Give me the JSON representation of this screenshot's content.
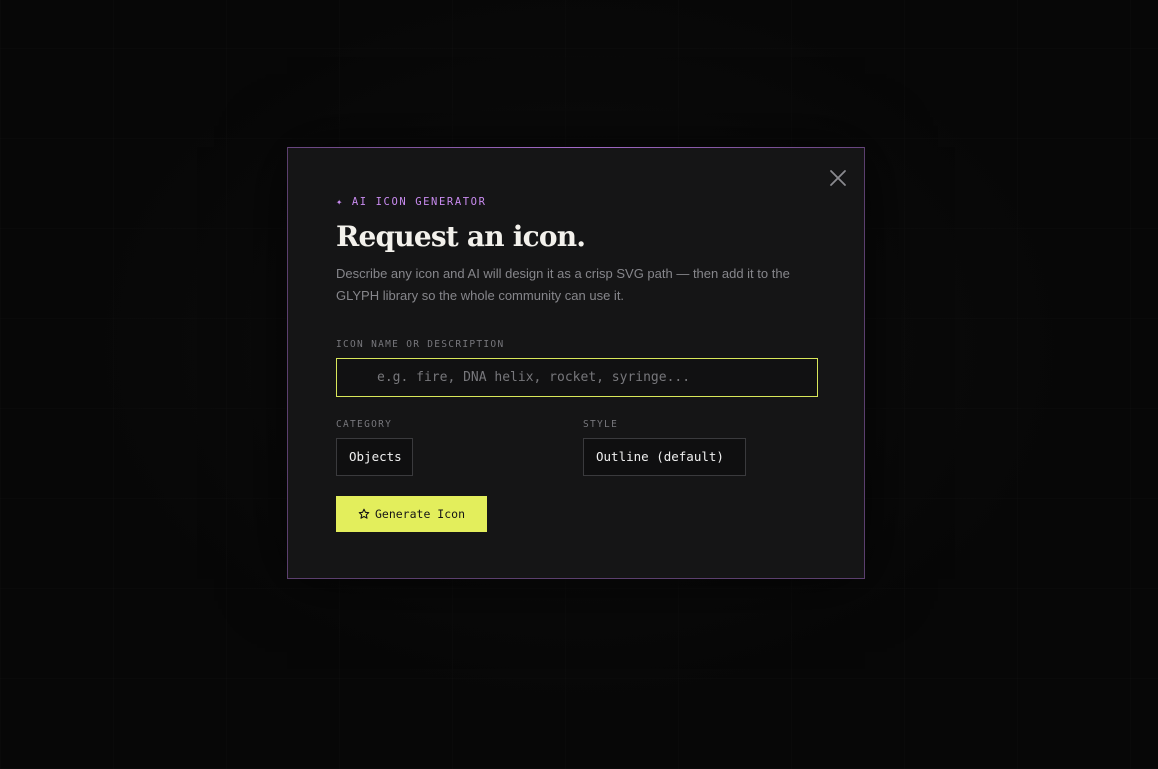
{
  "modal": {
    "eyebrow": "✦ AI ICON GENERATOR",
    "title": "Request an icon.",
    "description": "Describe any icon and AI will design it as a crisp SVG path — then add it to the GLYPH library so the whole community can use it.",
    "close_icon": "close-icon",
    "name_field": {
      "label": "ICON NAME OR DESCRIPTION",
      "placeholder": "e.g. fire, DNA helix, rocket, syringe...",
      "value": ""
    },
    "category": {
      "label": "CATEGORY",
      "selected": "Objects"
    },
    "style": {
      "label": "STYLE",
      "selected": "Outline (default)"
    },
    "generate_button": {
      "label": "Generate Icon",
      "icon": "star-icon"
    }
  },
  "colors": {
    "accent": "#e3ee5c",
    "eyebrow": "#c98bf0",
    "modal_border": "#5b3f6e",
    "modal_bg": "#151516",
    "backdrop": "#070707"
  }
}
